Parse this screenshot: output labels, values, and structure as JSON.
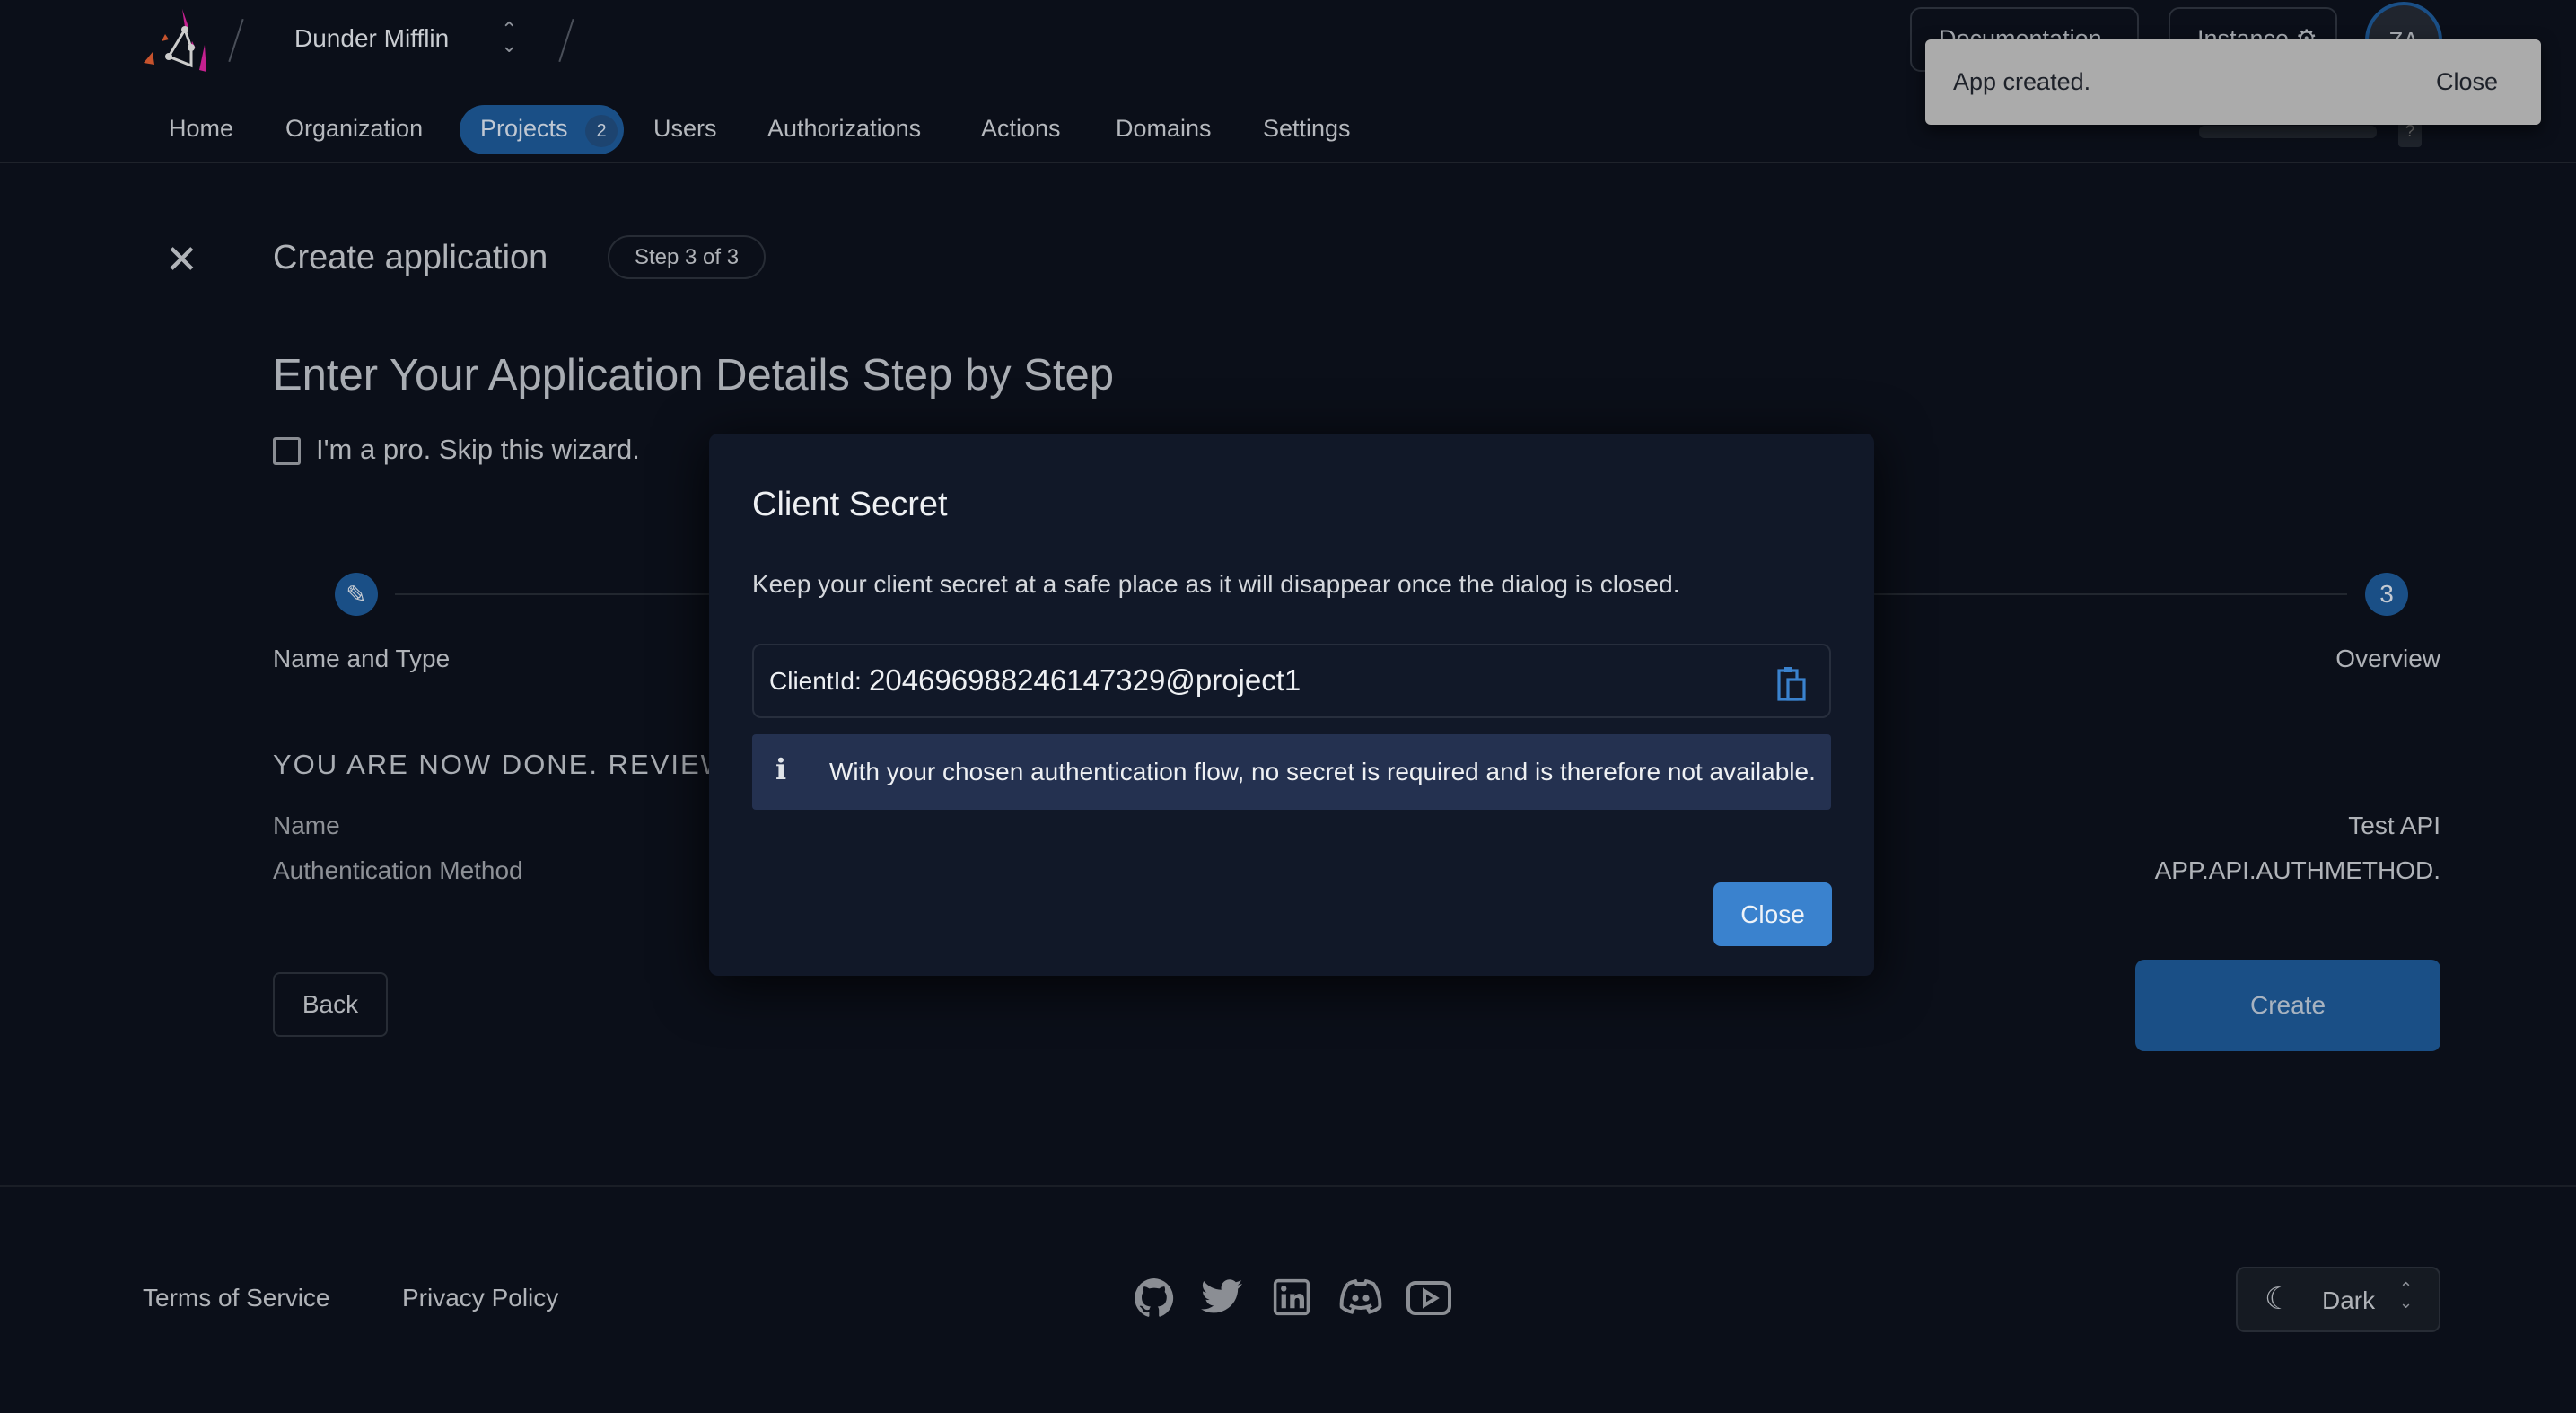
{
  "header": {
    "org_name": "Dunder Mifflin",
    "doc_button": "Documentation",
    "instance_button": "Instance",
    "avatar": "ZA",
    "nav": [
      {
        "label": "Home"
      },
      {
        "label": "Organization"
      },
      {
        "label": "Projects",
        "badge": "2",
        "active": true
      },
      {
        "label": "Users"
      },
      {
        "label": "Authorizations"
      },
      {
        "label": "Actions"
      },
      {
        "label": "Domains"
      },
      {
        "label": "Settings"
      }
    ]
  },
  "toast": {
    "message": "App created.",
    "close_label": "Close"
  },
  "page": {
    "title": "Create application",
    "step_badge": "Step 3 of 3",
    "heading": "Enter Your Application Details Step by Step",
    "skip_label": "I'm a pro. Skip this wizard.",
    "steps": [
      {
        "label": "Name and Type",
        "icon": "pencil-icon"
      },
      {
        "label": "Overview",
        "number": "3"
      }
    ],
    "review_heading": "YOU ARE NOW DONE. REVIEW",
    "review": [
      {
        "label": "Name",
        "value": "Test API"
      },
      {
        "label": "Authentication Method",
        "value": "APP.API.AUTHMETHOD."
      }
    ],
    "back_label": "Back",
    "create_label": "Create"
  },
  "dialog": {
    "title": "Client Secret",
    "description": "Keep your client secret at a safe place as it will disappear once the dialog is closed.",
    "client_id_label": "ClientId:",
    "client_id_value": "204696988246147329@project1",
    "info": "With your chosen authentication flow, no secret is required and is therefore not available.",
    "close_label": "Close"
  },
  "footer": {
    "terms": "Terms of Service",
    "privacy": "Privacy Policy",
    "social": [
      "github-icon",
      "twitter-icon",
      "linkedin-icon",
      "discord-icon",
      "youtube-icon"
    ],
    "theme": "Dark"
  },
  "colors": {
    "accent": "#1a4f86",
    "dialog_button": "#3a82ce",
    "info_bg": "#243150",
    "background": "#0b0f19"
  }
}
